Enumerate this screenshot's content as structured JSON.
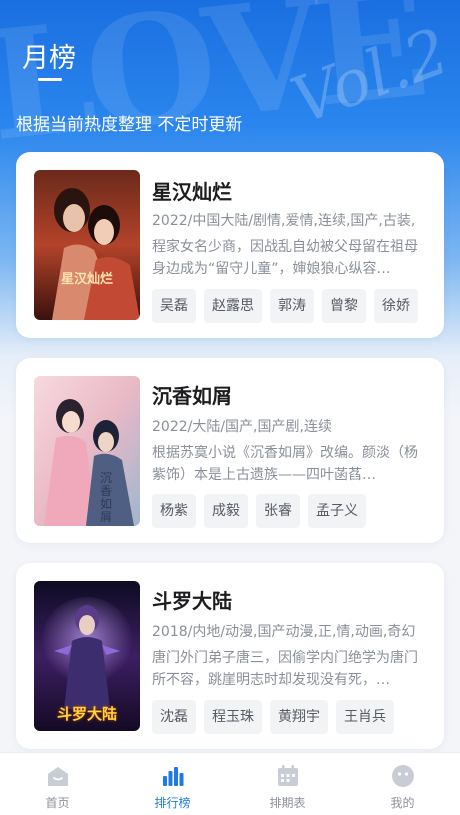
{
  "header": {
    "title": "月榜",
    "subtitle": "根据当前热度整理 不定时更新"
  },
  "items": [
    {
      "title": "星汉灿烂",
      "meta": "2022/中国大陆/剧情,爱情,连续,国产,古装,",
      "desc": "程家女名少商，因战乱自幼被父母留在祖母身边成为“留守儿童”，婶娘狼心纵容…",
      "tags": [
        "吴磊",
        "赵露思",
        "郭涛",
        "曾黎",
        "徐娇"
      ],
      "poster_text": "星汉灿烂"
    },
    {
      "title": "沉香如屑",
      "meta": "2022/大陆/国产,国产剧,连续",
      "desc": "根据苏寞小说《沉香如屑》改编。颜淡（杨紫饰）本是上古遗族——四叶菡萏…",
      "tags": [
        "杨紫",
        "成毅",
        "张睿",
        "孟子义"
      ],
      "poster_text": "沉香如屑"
    },
    {
      "title": "斗罗大陆",
      "meta": "2018/内地/动漫,国产动漫,正,情,动画,奇幻",
      "desc": "唐门外门弟子唐三，因偷学内门绝学为唐门所不容，跳崖明志时却发现没有死，…",
      "tags": [
        "沈磊",
        "程玉珠",
        "黄翔宇",
        "王肖兵"
      ],
      "poster_text": "斗罗大陆"
    }
  ],
  "tabbar": {
    "tabs": [
      {
        "label": "首页",
        "icon": "home-icon"
      },
      {
        "label": "排行榜",
        "icon": "ranking-icon"
      },
      {
        "label": "排期表",
        "icon": "calendar-icon"
      },
      {
        "label": "我的",
        "icon": "profile-icon"
      }
    ],
    "active_index": 1,
    "active_color": "#1f7ae6",
    "inactive_color": "#c8ccd4"
  }
}
